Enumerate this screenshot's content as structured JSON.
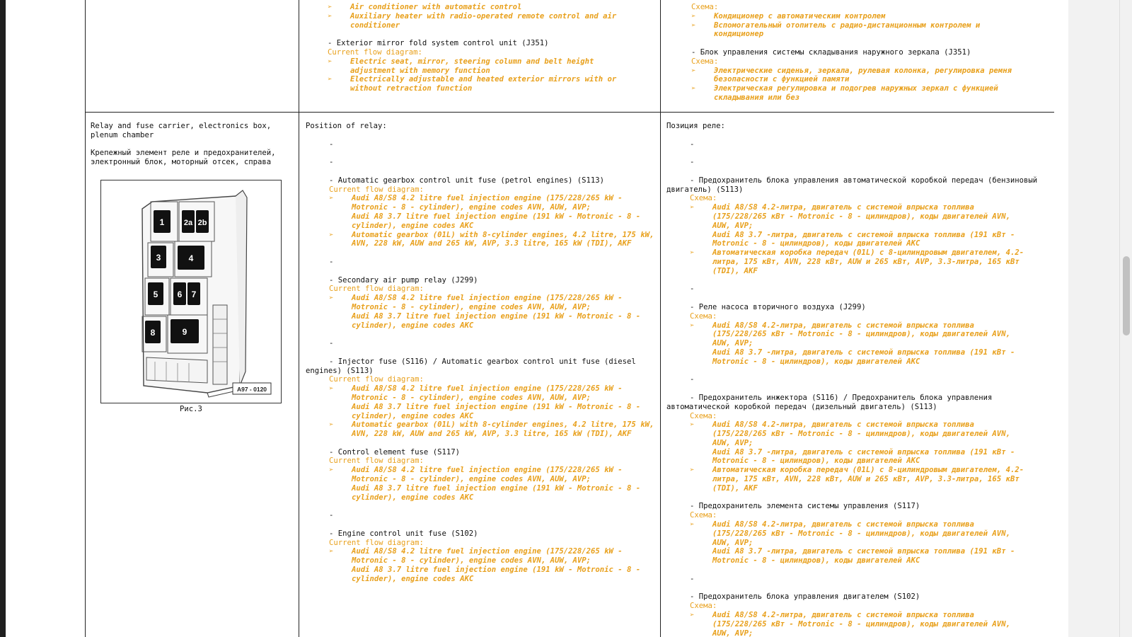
{
  "top": {
    "en": {
      "items_a": [
        "Air conditioner with automatic control",
        "Auxiliary heater with radio-operated remote control and air conditioner"
      ],
      "mirror_heading": "- Exterior mirror fold system control unit (J351)",
      "flow_label": "Current flow diagram:",
      "items_b": [
        "Electric seat, mirror, steering column and belt height adjustment with memory function",
        "Electrically adjustable and heated exterior mirrors with or without retraction function"
      ]
    },
    "ru": {
      "scheme_label": "Схема:",
      "items_a": [
        "Кондиционер с автоматическим контролем",
        "Вспомогательный отопитель с радио-дистанционным контролем и кондиционер"
      ],
      "mirror_heading": "- Блок управления системы складывания наружного зеркала (J351)",
      "flow_label": "Схема:",
      "items_b": [
        "Электрические сиденья, зеркала, рулевая колонка, регулировка ремня безопасности с функцией памяти",
        "Электрическая регулировка и подогрев наружных зеркал с функцией складывания или без"
      ]
    }
  },
  "left": {
    "title_en": "Relay and fuse carrier, electronics box, plenum chamber",
    "title_ru": "Крепежный элемент реле и предохранителей, электронный блок, моторный отсек, справа",
    "figure_label": "A97 - 0120",
    "caption": "Рис.3",
    "relay_numbers": [
      "1",
      "2a",
      "2b",
      "3",
      "4",
      "5",
      "6",
      "7",
      "8",
      "9"
    ]
  },
  "en": {
    "position_label": "Position of relay:",
    "dash": "-",
    "flow_label": "Current flow diagram:",
    "s113_heading": "- Automatic gearbox control unit fuse (petrol engines) (S113)",
    "s113_items": [
      "Audi A8/S8 4.2 litre fuel injection engine (175/228/265 kW - Motronic - 8 - cylinder), engine codes AVN, AUW, AVP;",
      "Automatic gearbox (01L) with 8-cylinder engines, 4.2 litre, 175 kW, AVN, 228 kW, AUW and 265 kW, AVP, 3.3 litre, 165 kW (TDI), AKF"
    ],
    "s113_sub": "Audi A8 3.7 litre  fuel injection engine (191 kW - Motronic - 8 - cylinder), engine codes AKC",
    "j299_heading": "- Secondary air pump relay (J299)",
    "j299_item": "Audi A8/S8 4.2 litre fuel injection engine (175/228/265 kW - Motronic - 8 - cylinder), engine codes AVN, AUW, AVP;",
    "j299_sub": "Audi A8 3.7 litre  fuel injection engine (191 kW - Motronic - 8 - cylinder), engine codes AKC",
    "s116_heading": "- Injector fuse (S116) / Automatic gearbox control unit fuse (diesel engines) (S113)",
    "s116_items": [
      "Audi A8/S8 4.2 litre fuel injection engine (175/228/265 kW - Motronic - 8 - cylinder), engine codes AVN, AUW, AVP;",
      "Automatic gearbox (01L) with 8-cylinder engines, 4.2 litre, 175 kW, AVN, 228 kW, AUW and 265 kW, AVP, 3.3 litre, 165 kW (TDI), AKF"
    ],
    "s116_sub": "Audi A8 3.7 litre  fuel injection engine (191 kW - Motronic - 8 - cylinder), engine codes AKC",
    "s117_heading": "- Control element fuse (S117)",
    "s117_item": "Audi A8/S8 4.2 litre fuel injection engine (175/228/265 kW - Motronic - 8 - cylinder), engine codes AVN, AUW, AVP;",
    "s117_sub": "Audi A8 3.7 litre  fuel injection engine (191 kW - Motronic - 8 - cylinder), engine codes AKC",
    "s102_heading": "- Engine control unit fuse (S102)",
    "s102_item": "Audi A8/S8 4.2 litre fuel injection engine (175/228/265 kW - Motronic - 8 - cylinder), engine codes AVN, AUW, AVP;",
    "s102_sub": "Audi A8 3.7 litre  fuel injection engine (191 kW - Motronic - 8 - cylinder), engine codes AKC"
  },
  "ru": {
    "position_label": "Позиция реле:",
    "dash": "-",
    "flow_label": "Схема:",
    "s113_heading": "- Предохранитель блока управления автоматической коробкой передач (бензиновый двигатель) (S113)",
    "s113_items": [
      "Audi A8/S8 4.2-литра, двигатель с системой впрыска топлива (175/228/265 кВт - Motronic - 8 - цилиндров), коды двигателей AVN, AUW, AVP;",
      "Автоматическая коробка передач (01L) с 8-цилиндровым двигателем, 4.2-литра, 175 кВт, AVN, 228 кВт, AUW и 265 кВт, AVP, 3.3-литра, 165 кВт (TDI), AKF"
    ],
    "s113_sub": "Audi A8 3.7 -литра, двигатель с системой впрыска топлива (191 кВт - Motronic - 8 - цилиндров), коды двигателей AKC",
    "j299_heading": "- Реле насоса вторичного воздуха (J299)",
    "j299_item": "Audi A8/S8 4.2-литра, двигатель с системой впрыска топлива (175/228/265 кВт - Motronic - 8 - цилиндров), коды двигателей AVN, AUW, AVP;",
    "j299_sub": "Audi A8 3.7 -литра, двигатель с системой впрыска топлива (191 кВт - Motronic - 8 - цилиндров), коды двигателей AKC",
    "s116_heading": "- Предохранитель инжектора (S116) / Предохранитель блока управления автоматической коробкой передач (дизельный двигатель) (S113)",
    "s116_items": [
      "Audi A8/S8 4.2-литра, двигатель с системой впрыска топлива (175/228/265 кВт - Motronic - 8 - цилиндров), коды двигателей AVN, AUW, AVP;",
      "Автоматическая коробка передач (01L) с 8-цилиндровым двигателем, 4.2-литра, 175 кВт, AVN, 228 кВт, AUW и 265 кВт, AVP, 3.3-литра, 165 кВт (TDI), AKF"
    ],
    "s116_sub": "Audi A8 3.7 -литра, двигатель с системой впрыска топлива (191 кВт - Motronic - 8 - цилиндров), коды двигателей AKC",
    "s117_heading": "- Предохранитель элемента системы управления (S117)",
    "s117_item": "Audi A8/S8 4.2-литра, двигатель с системой впрыска топлива (175/228/265 кВт - Motronic - 8 - цилиндров), коды двигателей AVN, AUW, AVP;",
    "s117_sub": "Audi A8 3.7 -литра, двигатель с системой впрыска топлива (191 кВт - Motronic - 8 - цилиндров), коды двигателей AKC",
    "s102_heading": "- Предохранитель блока управления двигателем (S102)",
    "s102_item": "Audi A8/S8 4.2-литра, двигатель с системой впрыска топлива (175/228/265 кВт - Motronic - 8 - цилиндров), коды двигателей AVN, AUW, AVP;"
  },
  "bullet": "➢",
  "colors": {
    "accent": "#e8a01c",
    "text": "#111111",
    "rule": "#222222"
  }
}
